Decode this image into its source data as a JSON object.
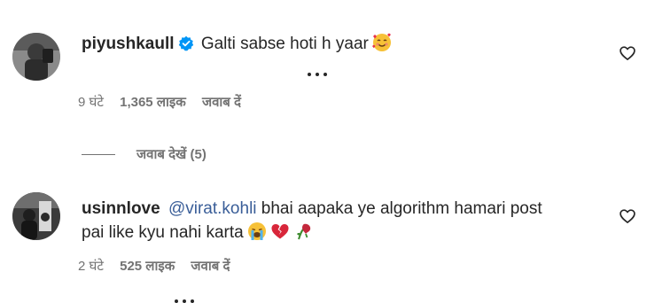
{
  "comments": [
    {
      "username": "piyushkaull",
      "verified": true,
      "text": "Galti sabse hoti h yaar",
      "emoji": "smiling-face-with-hearts",
      "time": "9 घंटे",
      "likes": "1,365 लाइक",
      "reply": "जवाब दें"
    },
    {
      "username": "usinnlove",
      "verified": false,
      "mention": "@virat.kohli",
      "text_line1": " bhai aapaka ye algorithm hamari post",
      "text_line2": "pai like kyu nahi karta",
      "emojis": [
        "loudly-crying-face",
        "broken-heart",
        "wilted-rose"
      ],
      "time": "2 घंटे",
      "likes": "525 लाइक",
      "reply": "जवाब दें"
    }
  ],
  "view_replies": "जवाब देखें (5)",
  "colors": {
    "text": "#262626",
    "muted": "#737373",
    "mention": "#3a5e98",
    "verified": "#0095f6"
  },
  "icons": [
    "verified-badge-icon",
    "heart-outline-icon",
    "more-options-icon"
  ]
}
